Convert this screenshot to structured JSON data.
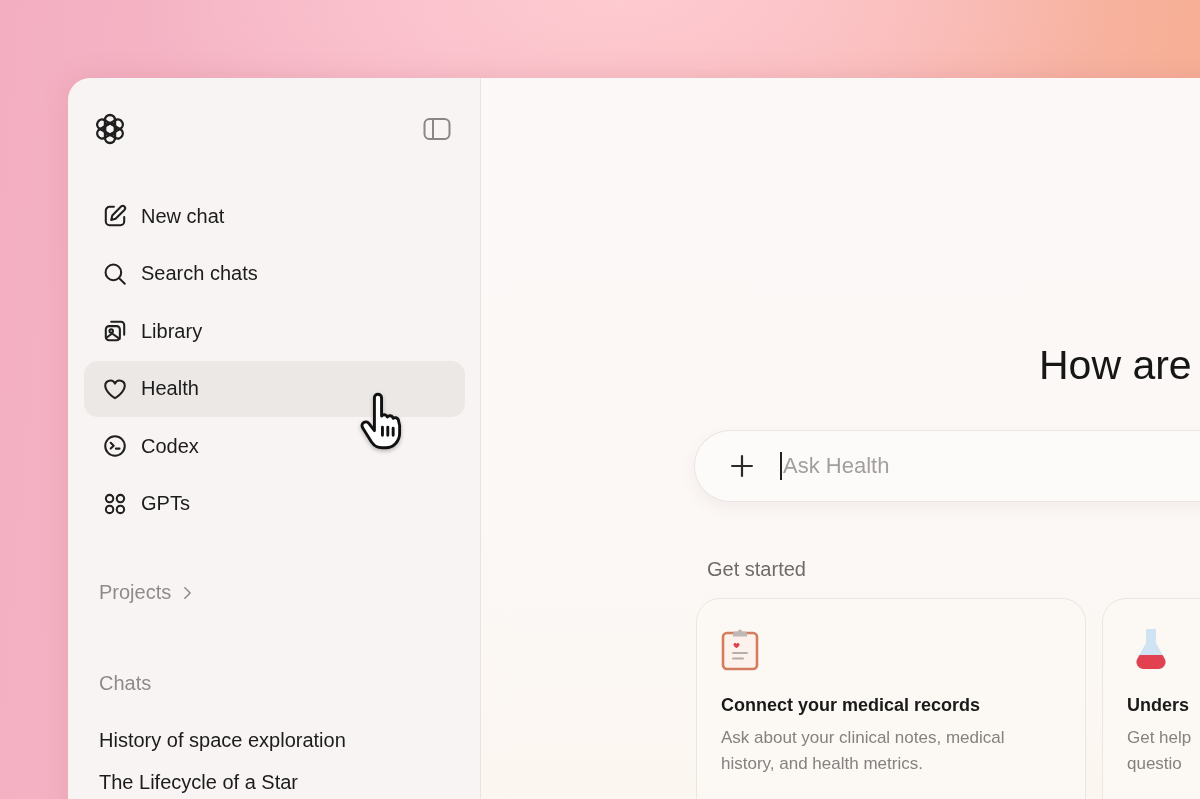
{
  "sidebar": {
    "items": [
      {
        "label": "New chat",
        "selected": false
      },
      {
        "label": "Search chats",
        "selected": false
      },
      {
        "label": "Library",
        "selected": false
      },
      {
        "label": "Health",
        "selected": true
      },
      {
        "label": "Codex",
        "selected": false
      },
      {
        "label": "GPTs",
        "selected": false
      }
    ],
    "projects_label": "Projects",
    "chats_heading": "Chats",
    "chats": [
      "History of space exploration",
      "The Lifecycle of a Star"
    ]
  },
  "main": {
    "heading": "How are",
    "composer": {
      "placeholder": "Ask Health"
    },
    "get_started_label": "Get started",
    "cards": [
      {
        "title": "Connect your medical records",
        "description_lines": [
          "Ask about your clinical notes, medical",
          "history, and health metrics."
        ]
      },
      {
        "title": "Unders",
        "description_lines": [
          "Get help",
          "questio"
        ]
      }
    ]
  }
}
